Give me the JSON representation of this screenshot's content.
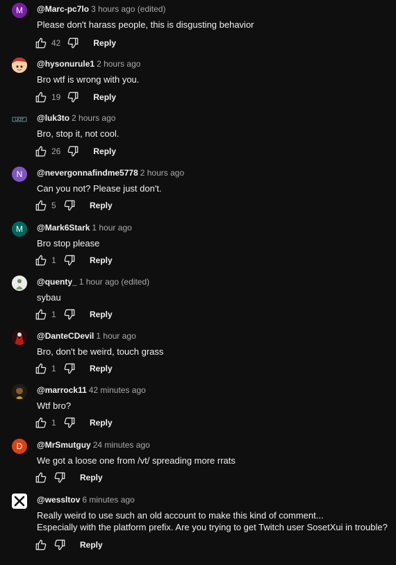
{
  "reply_label": "Reply",
  "colors": {
    "background": "#0f0f0f",
    "text": "#f1f1f1",
    "secondary_text": "#aaaaaa"
  },
  "comments": [
    {
      "author": "@Marc-pc7lo",
      "time": "3 hours ago (edited)",
      "lines": [
        "Please don't harass people, this is disgusting behavior"
      ],
      "likes": "42",
      "avatar": {
        "kind": "letter",
        "letter": "M",
        "color": "#7b1fa2"
      }
    },
    {
      "author": "@hysonurule1",
      "time": "2 hours ago",
      "lines": [
        "Bro wtf is wrong with you."
      ],
      "likes": "19",
      "avatar": {
        "kind": "image",
        "icon": "anime-face-avatar"
      }
    },
    {
      "author": "@luk3to",
      "time": "2 hours ago",
      "lines": [
        "Bro, stop it, not cool."
      ],
      "likes": "26",
      "avatar": {
        "kind": "image",
        "icon": "lk3t-logo-avatar"
      }
    },
    {
      "author": "@nevergonnafindme5778",
      "time": "2 hours ago",
      "lines": [
        "Can you not? Please just don't."
      ],
      "likes": "5",
      "avatar": {
        "kind": "letter",
        "letter": "N",
        "color": "#7e57c2"
      }
    },
    {
      "author": "@Mark6Stark",
      "time": "1 hour ago",
      "lines": [
        "Bro stop please"
      ],
      "likes": "1",
      "avatar": {
        "kind": "letter",
        "letter": "M",
        "color": "#00695c"
      }
    },
    {
      "author": "@quenty_",
      "time": "1 hour ago (edited)",
      "lines": [
        "sybau"
      ],
      "likes": "1",
      "avatar": {
        "kind": "image",
        "icon": "figure-avatar"
      }
    },
    {
      "author": "@DanteCDevil",
      "time": "1 hour ago",
      "lines": [
        "Bro, don't be weird, touch grass"
      ],
      "likes": "1",
      "avatar": {
        "kind": "image",
        "icon": "red-character-avatar"
      }
    },
    {
      "author": "@marrock11",
      "time": "42 minutes ago",
      "lines": [
        "Wtf bro?"
      ],
      "likes": "1",
      "avatar": {
        "kind": "image",
        "icon": "dark-character-avatar"
      }
    },
    {
      "author": "@MrSmutguy",
      "time": "24 minutes ago",
      "lines": [
        "We got a loose one from /vt/ spreading more rrats"
      ],
      "likes": "",
      "avatar": {
        "kind": "letter",
        "letter": "D",
        "color": "#d84315"
      }
    },
    {
      "author": "@wessltov",
      "time": "6 minutes ago",
      "lines": [
        "Really weird to use such an old account to make this kind of comment...",
        "Especially with the platform prefix. Are you trying to get Twitch user SosetXui in trouble?"
      ],
      "likes": "",
      "avatar": {
        "kind": "image",
        "icon": "x-logo-avatar"
      }
    }
  ]
}
